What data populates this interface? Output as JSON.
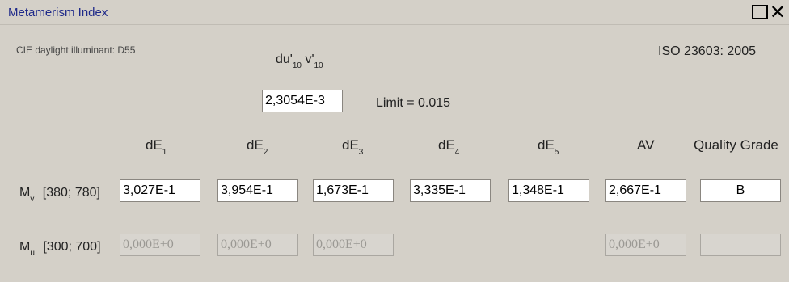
{
  "window": {
    "title": "Metamerism Index"
  },
  "info": {
    "illuminant": "CIE daylight illuminant: D55",
    "standard": "ISO 23603: 2005"
  },
  "duv": {
    "label_du": "du'",
    "label_du_sub": "10",
    "label_dv": "v'",
    "label_dv_sub": "10",
    "value": "2,3054E-3",
    "limit_label": "Limit = 0.015"
  },
  "headers": {
    "dE": "dE",
    "dE_subs": [
      "1",
      "2",
      "3",
      "4",
      "5"
    ],
    "av": "AV",
    "quality": "Quality Grade"
  },
  "rows": {
    "mv": {
      "label_m": "M",
      "label_sub": "v",
      "range": "[380; 780]",
      "values": [
        "3,027E-1",
        "3,954E-1",
        "1,673E-1",
        "3,335E-1",
        "1,348E-1"
      ],
      "av": "2,667E-1",
      "grade": "B"
    },
    "mu": {
      "label_m": "M",
      "label_sub": "u",
      "range": "[300; 700]",
      "values": [
        "0,000E+0",
        "0,000E+0",
        "0,000E+0"
      ],
      "av": "0,000E+0",
      "grade": ""
    }
  }
}
